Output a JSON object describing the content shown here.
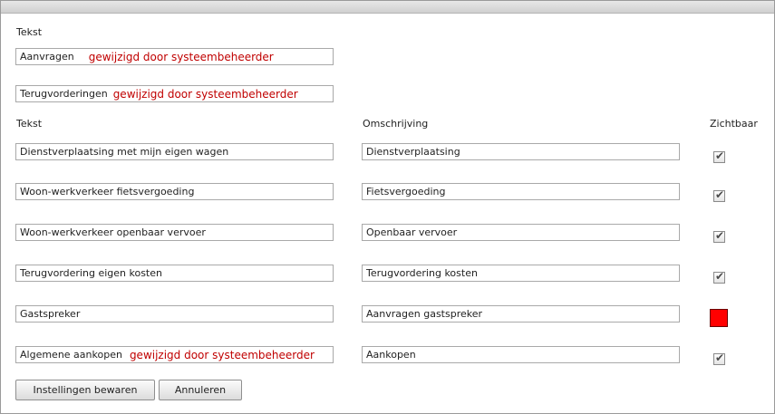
{
  "top_section": {
    "label": "Tekst",
    "fields": [
      {
        "text": "Aanvragen",
        "modified": "gewijzigd door systeembeheerder"
      },
      {
        "text": "Terugvorderingen",
        "modified": "gewijzigd door systeembeheerder"
      }
    ]
  },
  "table": {
    "headers": {
      "tekst": "Tekst",
      "omschrijving": "Omschrijving",
      "zichtbaar": "Zichtbaar"
    },
    "rows": [
      {
        "tekst": "Dienstverplaatsing met mijn eigen wagen",
        "omschrijving": "Dienstverplaatsing",
        "zichtbaar": true
      },
      {
        "tekst": "Woon-werkverkeer fietsvergoeding",
        "omschrijving": "Fietsvergoeding",
        "zichtbaar": true
      },
      {
        "tekst": "Woon-werkverkeer openbaar vervoer",
        "omschrijving": "Openbaar vervoer",
        "zichtbaar": true
      },
      {
        "tekst": "Terugvordering eigen kosten",
        "omschrijving": "Terugvordering kosten",
        "zichtbaar": true
      },
      {
        "tekst": "Gastspreker",
        "omschrijving": "Aanvragen gastspreker",
        "zichtbaar": "invalid"
      },
      {
        "tekst": "Algemene aankopen",
        "modified": "gewijzigd door systeembeheerder",
        "omschrijving": "Aankopen",
        "zichtbaar": true
      }
    ]
  },
  "buttons": {
    "save": "Instellingen bewaren",
    "cancel": "Annuleren"
  },
  "colors": {
    "modified_text": "#c00000",
    "invalid_checkbox": "#ff0000"
  }
}
